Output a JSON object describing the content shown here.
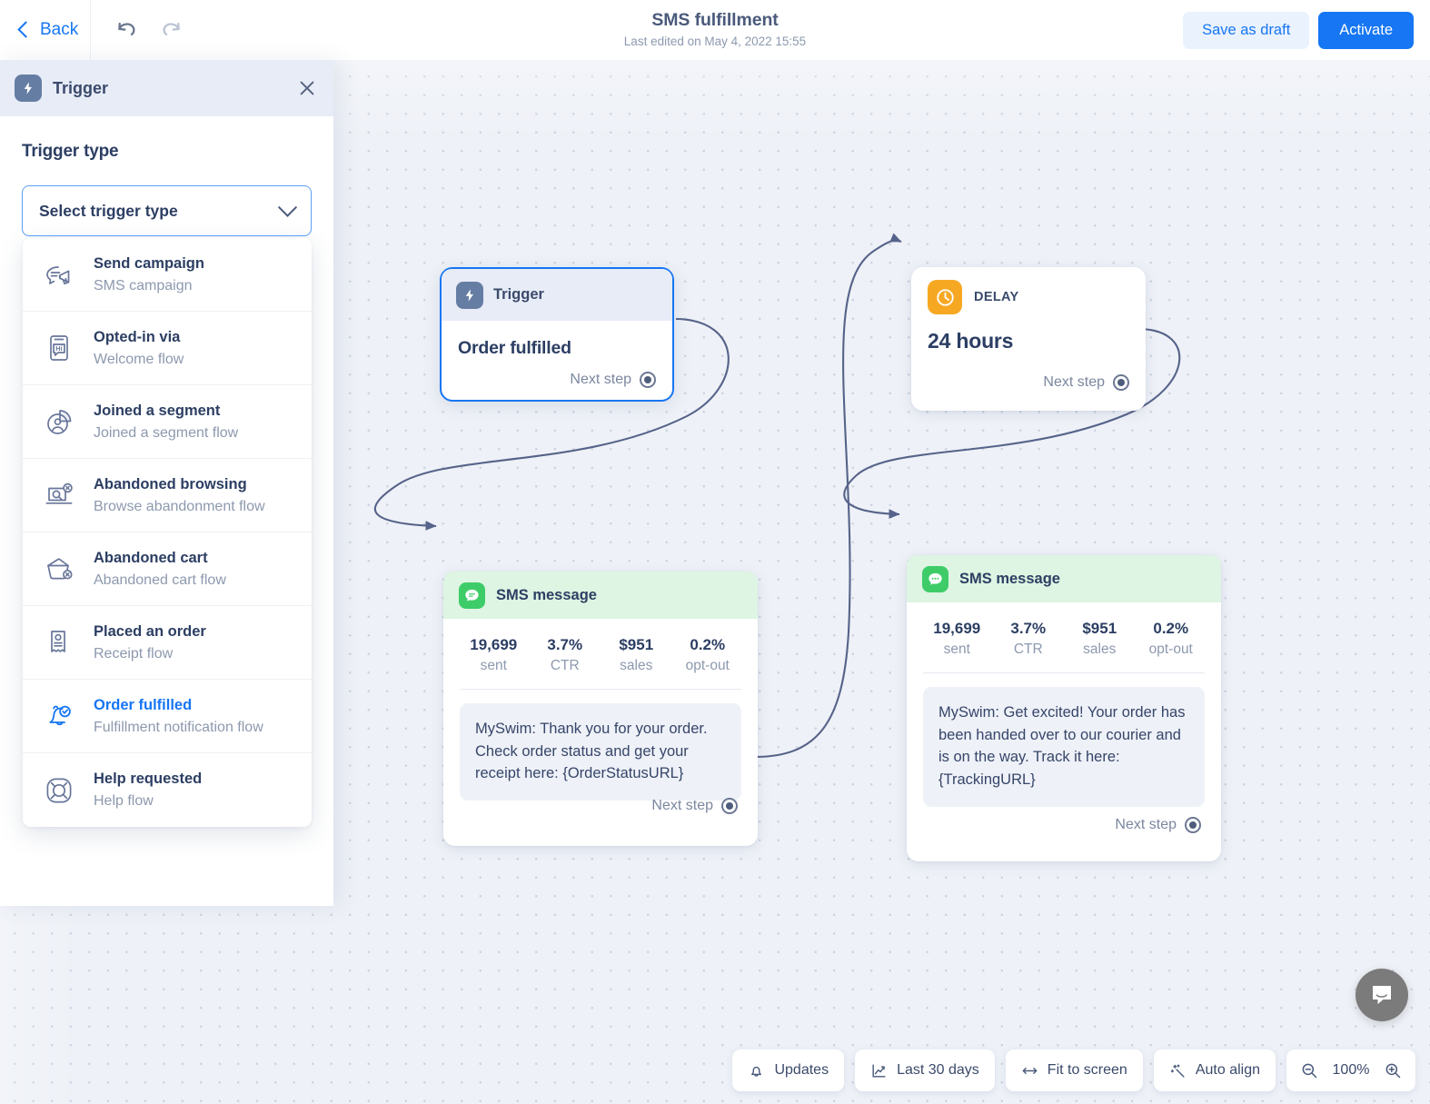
{
  "topbar": {
    "back_label": "Back",
    "undo_icon": "undo-icon",
    "redo_icon": "redo-icon",
    "title": "SMS fulfillment",
    "subtitle": "Last edited on May 4, 2022 15:55",
    "save_draft_label": "Save as draft",
    "activate_label": "Activate",
    "accent_color": "#1676f3",
    "draft_bg_color": "#eaf2fe"
  },
  "panel": {
    "header_title": "Trigger",
    "header_icon": "lightning-bolt-icon",
    "close_icon": "close-icon",
    "section_title": "Trigger type",
    "select": {
      "value": "Select trigger type",
      "chevron_icon": "chevron-down-icon"
    },
    "options": [
      {
        "title": "Send campaign",
        "subtitle": "SMS campaign",
        "icon": "speech-bubble-megaphone-icon",
        "selected": false
      },
      {
        "title": "Opted-in via",
        "subtitle": "Welcome flow",
        "icon": "phone-hi-message-icon",
        "selected": false
      },
      {
        "title": "Joined a segment",
        "subtitle": "Joined a segment flow",
        "icon": "pie-chart-person-icon",
        "selected": false
      },
      {
        "title": "Abandoned browsing",
        "subtitle": "Browse abandonment flow",
        "icon": "laptop-search-x-icon",
        "selected": false
      },
      {
        "title": "Abandoned cart",
        "subtitle": "Abandoned cart flow",
        "icon": "cart-x-icon",
        "selected": false
      },
      {
        "title": "Placed an order",
        "subtitle": "Receipt flow",
        "icon": "receipt-icon",
        "selected": false
      },
      {
        "title": "Order fulfilled",
        "subtitle": "Fulfillment notification flow",
        "icon": "bell-check-icon",
        "selected": true
      },
      {
        "title": "Help requested",
        "subtitle": "Help flow",
        "icon": "life-ring-icon",
        "selected": false
      }
    ]
  },
  "canvas": {
    "zoom_level": "100%",
    "next_step_label": "Next step",
    "trigger_node": {
      "header_label": "Trigger",
      "header_icon": "lightning-bolt-icon",
      "value": "Order fulfilled",
      "selected": true
    },
    "delay_node": {
      "header_label": "DELAY",
      "header_icon": "clock-icon",
      "header_color": "#f7a823",
      "value": "24 hours"
    },
    "sms_nodes": [
      {
        "header_label": "SMS message",
        "header_icon": "sms-chat-lines-icon",
        "header_color": "#3ecc69",
        "stats": [
          {
            "value": "19,699",
            "label": "sent"
          },
          {
            "value": "3.7%",
            "label": "CTR"
          },
          {
            "value": "$951",
            "label": "sales"
          },
          {
            "value": "0.2%",
            "label": "opt-out"
          }
        ],
        "message_text": "MySwim: Thank you for your order. Check order status and get your receipt here: ",
        "message_variable": "{OrderStatusURL}"
      },
      {
        "header_label": "SMS message",
        "header_icon": "sms-chat-dots-icon",
        "header_color": "#3ecc69",
        "stats": [
          {
            "value": "19,699",
            "label": "sent"
          },
          {
            "value": "3.7%",
            "label": "CTR"
          },
          {
            "value": "$951",
            "label": "sales"
          },
          {
            "value": "0.2%",
            "label": "opt-out"
          }
        ],
        "message_text": "MySwim: Get excited! Your order has been handed over to our courier and is on the way. Track it here: ",
        "message_variable": "{TrackingURL}"
      }
    ]
  },
  "bottombar": {
    "updates_label": "Updates",
    "updates_icon": "bell-icon",
    "date_range_label": "Last 30 days",
    "date_range_icon": "chart-line-icon",
    "fit_label": "Fit to screen",
    "fit_icon": "arrows-horizontal-icon",
    "autoalign_label": "Auto align",
    "autoalign_icon": "magic-wand-icon",
    "zoom_value": "100%",
    "zoom_out_icon": "zoom-out-icon",
    "zoom_in_icon": "zoom-in-icon"
  },
  "chat_launcher": {
    "icon": "chat-bubble-icon"
  }
}
